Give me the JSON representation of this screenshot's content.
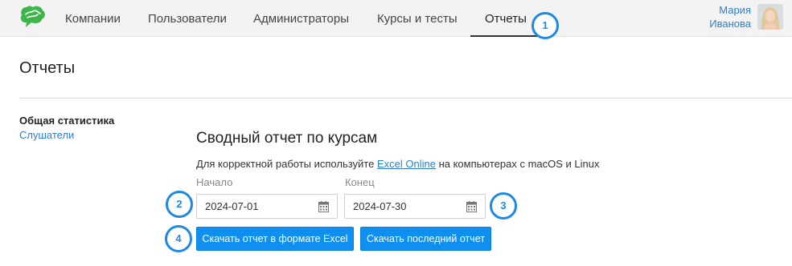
{
  "nav": {
    "items": [
      {
        "label": "Компании"
      },
      {
        "label": "Пользователи"
      },
      {
        "label": "Администраторы"
      },
      {
        "label": "Курсы и тесты"
      },
      {
        "label": "Отчеты",
        "active": true
      }
    ]
  },
  "user": {
    "first_name": "Мария",
    "last_name": "Иванова"
  },
  "page": {
    "title": "Отчеты"
  },
  "sidebar": {
    "heading": "Общая статистика",
    "items": [
      {
        "label": "Слушатели"
      }
    ]
  },
  "report": {
    "title": "Сводный отчет по курсам",
    "note_prefix": "Для корректной работы используйте ",
    "note_link": "Excel Online",
    "note_suffix": " на компьютерах с macOS и Linux",
    "start_label": "Начало",
    "start_value": "2024-07-01",
    "end_label": "Конец",
    "end_value": "2024-07-30",
    "excel_button": "Скачать отчет в формате Excel",
    "last_button": "Скачать последний отчет"
  },
  "markers": [
    "1",
    "2",
    "3",
    "4"
  ],
  "colors": {
    "accent": "#0f8ff0",
    "link": "#2a7fd4",
    "marker": "#1e88e5",
    "logo": "#3cb54a"
  }
}
